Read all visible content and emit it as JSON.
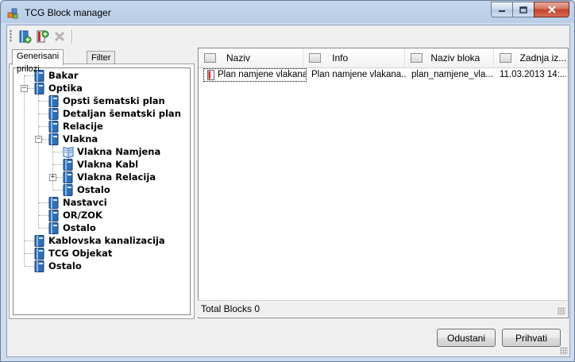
{
  "window": {
    "title": "TCG Block manager",
    "icon": "tcg-app-icon"
  },
  "caption_buttons": {
    "minimize": "minimize-icon",
    "maximize": "maximize-icon",
    "close": "close-icon"
  },
  "toolbar": {
    "buttons": [
      {
        "name": "new-block-icon"
      },
      {
        "name": "add-block-icon"
      },
      {
        "name": "delete-block-icon"
      }
    ]
  },
  "tabs": [
    {
      "label": "Generisani prilozi",
      "active": true
    },
    {
      "label": "Filter",
      "active": false
    }
  ],
  "tree": [
    {
      "label": "Bakar",
      "level": 0
    },
    {
      "label": "Optika",
      "level": 0,
      "expanded": true
    },
    {
      "label": "Opsti šematski plan",
      "level": 1
    },
    {
      "label": "Detaljan šematski plan",
      "level": 1
    },
    {
      "label": "Relacije",
      "level": 1
    },
    {
      "label": "Vlakna",
      "level": 1,
      "expanded": true
    },
    {
      "label": "Vlakna Namjena",
      "level": 2,
      "open": true
    },
    {
      "label": "Vlakna Kabl",
      "level": 2
    },
    {
      "label": "Vlakna Relacija",
      "level": 2,
      "collapsed": true
    },
    {
      "label": "Ostalo",
      "level": 2
    },
    {
      "label": "Nastavci",
      "level": 1
    },
    {
      "label": "OR/ZOK",
      "level": 1
    },
    {
      "label": "Ostalo",
      "level": 1
    },
    {
      "label": "Kablovska kanalizacija",
      "level": 0
    },
    {
      "label": "TCG Objekat",
      "level": 0
    },
    {
      "label": "Ostalo",
      "level": 0
    }
  ],
  "grid": {
    "columns": [
      "Naziv",
      "Info",
      "Naziv bloka",
      "Zadnja iz..."
    ],
    "rows": [
      [
        "Plan namjene vlakana",
        "Plan namjene vlakana...",
        "plan_namjene_vla...",
        "11.03.2013 14:..."
      ]
    ]
  },
  "status": {
    "text": "Total Blocks 0"
  },
  "buttons": {
    "cancel": "Odustani",
    "accept": "Prihvati"
  },
  "colors": {
    "book_blue": "#2f6fb6",
    "title_bar": "#b9cde7",
    "close_red": "#c2442b"
  }
}
